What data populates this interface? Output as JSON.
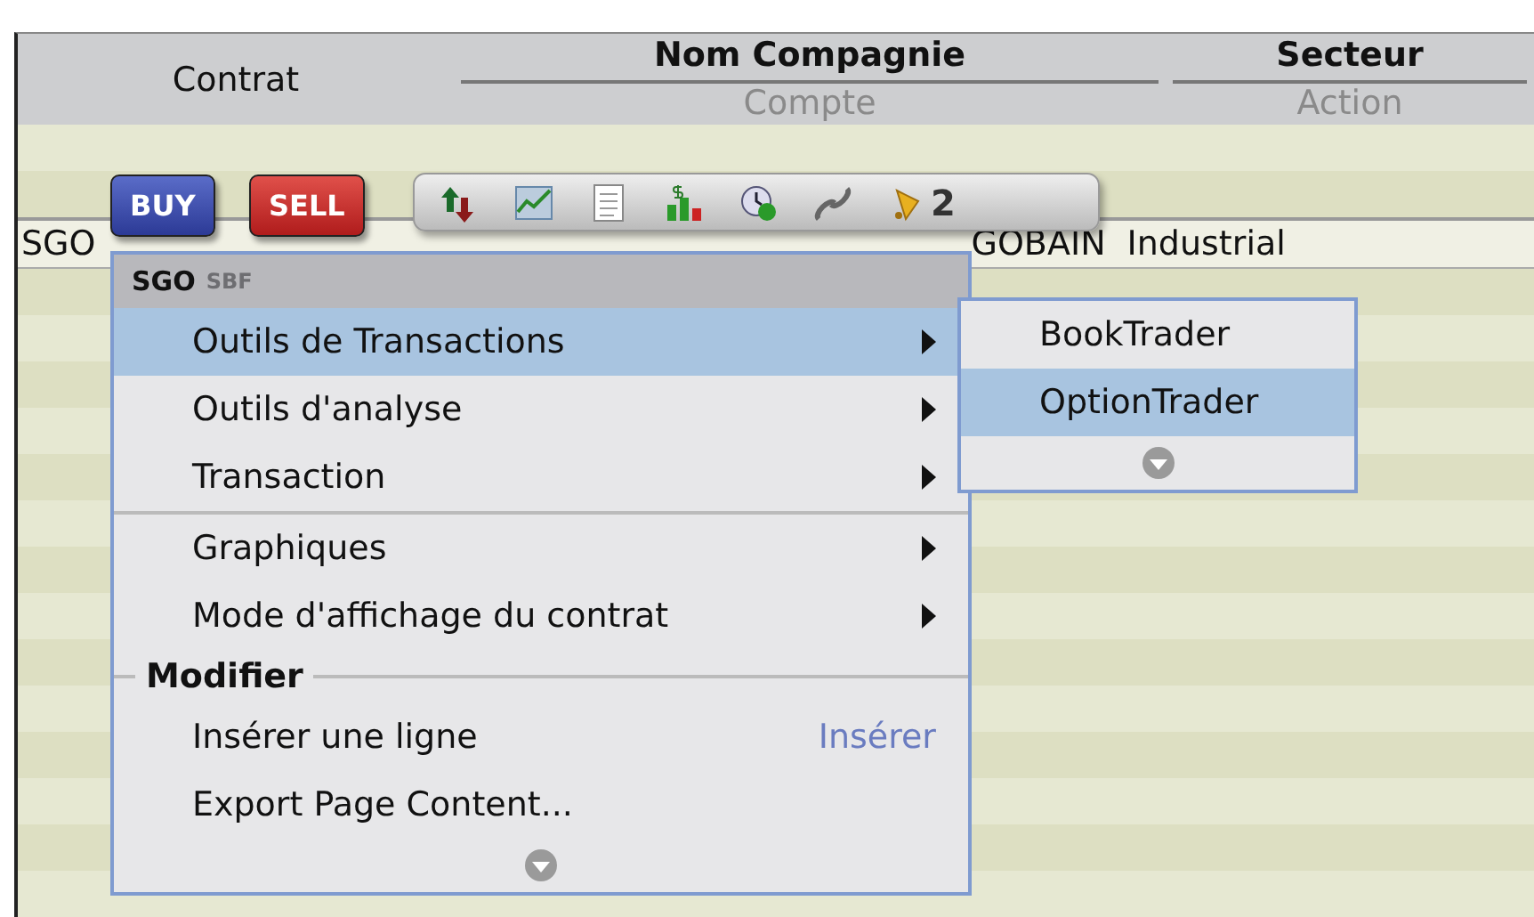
{
  "columns": [
    {
      "title": "Contrat"
    },
    {
      "title": "Nom Compagnie",
      "subtitle": "Compte"
    },
    {
      "title": "Secteur",
      "subtitle": "Action"
    }
  ],
  "row": {
    "symbol": "SGO",
    "company": "GOBAIN",
    "sector": "Industrial"
  },
  "order_buttons": [
    {
      "label": "BUY",
      "kind": "buy"
    },
    {
      "label": "SELL",
      "kind": "sell"
    }
  ],
  "toolbar": {
    "alert_count": "2"
  },
  "context_menu": {
    "symbol": "SGO",
    "exchange": "SBF",
    "items": [
      {
        "kind": "item",
        "label": "Outils de Transactions",
        "submenu": true,
        "selected": true
      },
      {
        "kind": "item",
        "label": "Outils d'analyse",
        "submenu": true,
        "selected": false
      },
      {
        "kind": "item",
        "label": "Transaction",
        "submenu": true,
        "selected": false
      },
      {
        "kind": "separator"
      },
      {
        "kind": "item",
        "label": "Graphiques",
        "submenu": true,
        "selected": false
      },
      {
        "kind": "item",
        "label": "Mode d'affichage du contrat",
        "submenu": true,
        "selected": false
      },
      {
        "kind": "section",
        "label": "Modifier"
      },
      {
        "kind": "item",
        "label": "Insérer une ligne",
        "shortcut": "Insérer",
        "submenu": false,
        "selected": false
      },
      {
        "kind": "item",
        "label": "Export Page Content...",
        "submenu": false,
        "selected": false
      },
      {
        "kind": "more"
      }
    ]
  },
  "submenu": {
    "items": [
      {
        "label": "BookTrader",
        "selected": false
      },
      {
        "label": "OptionTrader",
        "selected": true
      }
    ]
  }
}
